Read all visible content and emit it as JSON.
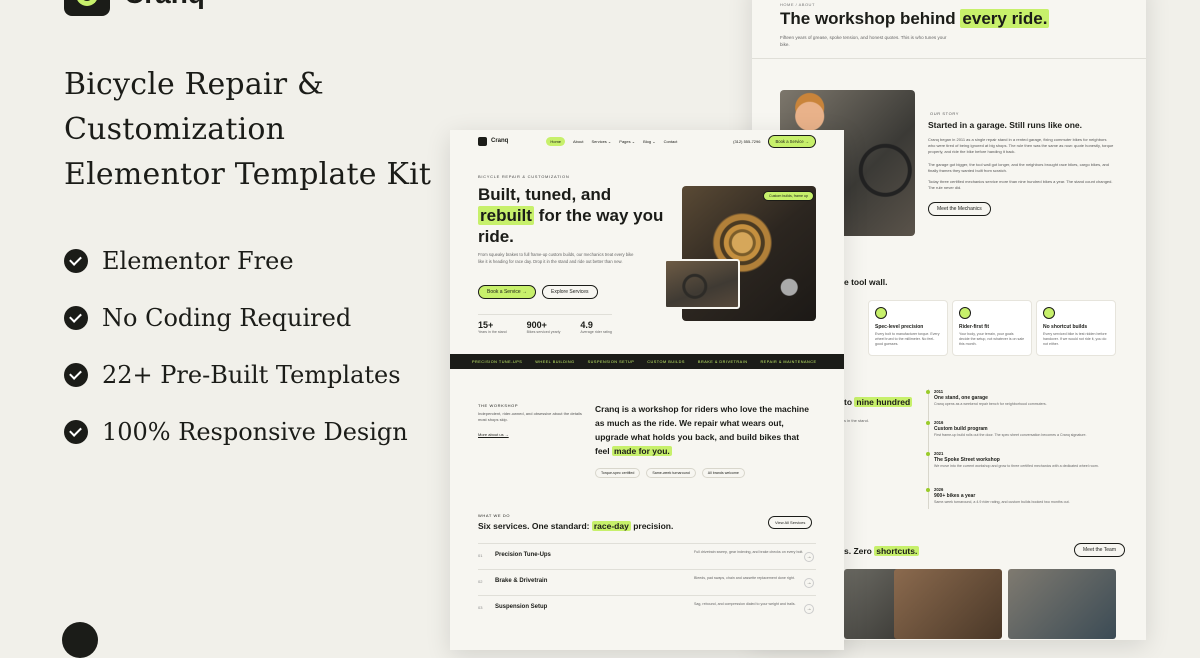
{
  "brand": {
    "name": "Cranq"
  },
  "kit": {
    "title_line1": "Bicycle Repair & Customization",
    "title_line2": "Elementor Template Kit"
  },
  "features": [
    "Elementor Free",
    "No Coding Required",
    "22+ Pre-Built Templates",
    "100% Responsive Design"
  ],
  "colors": {
    "accent": "#c7f06b",
    "dark": "#1b1c18",
    "background": "#f1f0ea"
  },
  "home": {
    "nav": {
      "brand": "Cranq",
      "links": [
        "Home",
        "About",
        "Services ⌄",
        "Pages ⌄",
        "Blog ⌄",
        "Contact"
      ],
      "phone": "(312) 555-7296",
      "cta": "Book a Service →"
    },
    "hero": {
      "eyebrow": "BICYCLE REPAIR & CUSTOMIZATION",
      "h_part1": "Built, tuned, and ",
      "h_highlight": "rebuilt",
      "h_part2": " for the way you ride.",
      "paragraph": "From squeaky brakes to full frame-up custom builds, our mechanics treat every bike like it is heading for race day. Drop it in the stand and ride out better than new.",
      "primary_btn": "Book a Service →",
      "secondary_btn": "Explore Services",
      "image_tag": "Custom builds, frame up",
      "stats": [
        {
          "value": "15+",
          "label": "Years in the stand"
        },
        {
          "value": "900+",
          "label": "Bikes serviced yearly"
        },
        {
          "value": "4.9",
          "label": "Average rider rating"
        }
      ]
    },
    "ticker": [
      "PRECISION TUNE-UPS",
      "WHEEL BUILDING",
      "SUSPENSION SETUP",
      "CUSTOM BUILDS",
      "BRAKE & DRIVETRAIN",
      "REPAIR & MAINTENANCE"
    ],
    "workshop": {
      "tag": "THE WORKSHOP",
      "paragraph": "Independent, rider-owned, and obsessive about the details most shops skip.",
      "link": "More about us →",
      "statement": "Cranq is a workshop for riders who love the machine as much as the ride. We repair what wears out, upgrade what holds you back, and build bikes that feel ",
      "statement_hl": "made for you.",
      "chips": [
        "Torque-spec certified",
        "Same-week turnaround",
        "All brands welcome"
      ]
    },
    "services": {
      "tag": "WHAT WE DO",
      "title_part1": "Six services. One standard: ",
      "title_hl": "race-day",
      "title_part2": " precision.",
      "view_all": "View All Services",
      "items": [
        {
          "num": "01",
          "title": "Precision Tune-Ups",
          "desc": "Full drivetrain sweep, gear indexing, and brake checks on every bolt."
        },
        {
          "num": "02",
          "title": "Brake & Drivetrain",
          "desc": "Bleeds, pad swaps, chain and cassette replacement done right."
        },
        {
          "num": "03",
          "title": "Suspension Setup",
          "desc": "Sag, rebound, and compression dialed to your weight and trails."
        }
      ]
    }
  },
  "about": {
    "crumb": "HOME / ABOUT",
    "head_part1": "The workshop behind ",
    "head_hl": "every ride.",
    "lead": "Fifteen years of grease, spoke tension, and honest quotes. This is who tunes your bike.",
    "story_tag": "OUR STORY",
    "story_title": "Started in a garage. Still runs like one.",
    "story_p1": "Cranq began in 2011 as a single repair stand in a rented garage, fixing commuter bikes for neighbors who were tired of being ignored at big shops. The rule then was the same as now: quote honestly, torque properly, and ride the bike before handing it back.",
    "story_p2": "The garage got bigger, the tool wall got longer, and the neighbors brought race bikes, cargo bikes, and finally frames they wanted built from scratch.",
    "story_p3": "Today three certified mechanics service more than nine hundred bikes a year. The stand count changed. The rule never did.",
    "meet_btn": "Meet the Mechanics",
    "wall_title": "e tool wall.",
    "values": [
      {
        "title": "Spec-level precision",
        "desc": "Every bolt to manufacturer torque. Every wheel trued to the millimeter. No feel-good guesses."
      },
      {
        "title": "Rider-first fit",
        "desc": "Your body, your terrain, your goals decide the setup, not whatever is on sale this month."
      },
      {
        "title": "No shortcut builds",
        "desc": "Every serviced bike is test ridden before handover. If we would not ride it, you do not either."
      }
    ],
    "timeline_title_part": "to ",
    "timeline_title_hl": "nine hundred",
    "timeline_left": "s in the stand.",
    "timeline": [
      {
        "year": "2011",
        "title": "One stand, one garage",
        "desc": "Cranq opens as a weekend repair bench for neighborhood commuters."
      },
      {
        "year": "2016",
        "title": "Custom build program",
        "desc": "First frame-up build rolls out the door. The spec sheet conversation becomes a Cranq signature."
      },
      {
        "year": "2021",
        "title": "The Spoke Street workshop",
        "desc": "We move into the current workshop and grow to three certified mechanics with a dedicated wheel room."
      },
      {
        "year": "2026",
        "title": "900+ bikes a year",
        "desc": "Same-week turnaround, a 4.9 rider rating, and custom builds booked two months out."
      }
    ],
    "team_title_part": "s. Zero ",
    "team_title_hl": "shortcuts.",
    "team_btn": "Meet the Team"
  }
}
